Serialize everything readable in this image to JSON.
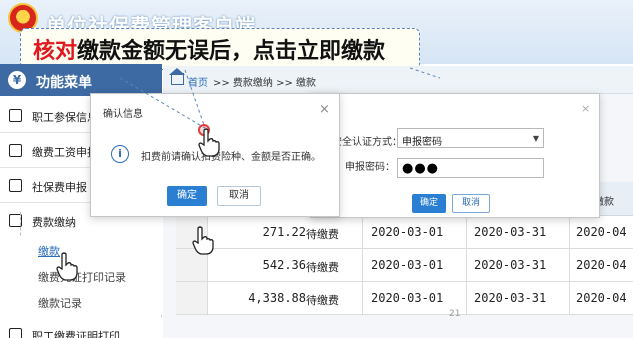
{
  "header": {
    "app_title": "单位社保费管理客户端",
    "callout_red": "核对",
    "callout_black": "缴款金额无误后，点击立即缴款"
  },
  "sidebar": {
    "menu_title": "功能菜单",
    "menu_icon": "¥",
    "items": [
      {
        "label": "职工参保信息"
      },
      {
        "label": "缴费工资申报"
      },
      {
        "label": "社保费申报"
      },
      {
        "label": "费款缴纳"
      }
    ],
    "sub_items": [
      {
        "label": "缴款"
      },
      {
        "label": "缴费凭证打印记录"
      },
      {
        "label": "缴款记录"
      }
    ],
    "last_item_partial": "职工缴费证明打印"
  },
  "breadcrumb": {
    "home": "首页",
    "rest": ">> 费款缴纳 >> 缴款"
  },
  "grid": {
    "partial_header": "缴款",
    "rows": [
      {
        "amount": "271.22",
        "status": "待缴费",
        "start": "2020-03-01",
        "end": "2020-03-31",
        "next": "2020-04"
      },
      {
        "amount": "542.36",
        "status": "待缴费",
        "start": "2020-03-01",
        "end": "2020-03-31",
        "next": "2020-04"
      },
      {
        "amount": "4,338.88",
        "status": "待缴费",
        "start": "2020-03-01",
        "end": "2020-03-31",
        "next": "2020-04"
      }
    ],
    "page_number": "21"
  },
  "confirm_dialog": {
    "title": "确认信息",
    "close": "×",
    "icon": "i",
    "message": "扣费前请确认扣费险种、金额是否正确。",
    "ok_label": "确定",
    "cancel_label": "取消"
  },
  "auth_dialog": {
    "title_partial": "证",
    "close": "×",
    "method_label": "安全认证方式：",
    "method_value": "申报密码",
    "method_arrow": "▼",
    "password_label": "申报密码：",
    "password_value": "●●●",
    "ok_label": "确定",
    "cancel_label": "取消"
  },
  "colors": {
    "accent": "#2b7fd3",
    "menu_bg": "#3d6aa3",
    "callout_red": "#e0191f"
  },
  "icons": [
    "emblem-icon",
    "yen-icon",
    "list-icon",
    "edit-icon",
    "calendar-icon",
    "wallet-icon",
    "home-icon",
    "info-icon",
    "hand-pointer-icon"
  ]
}
